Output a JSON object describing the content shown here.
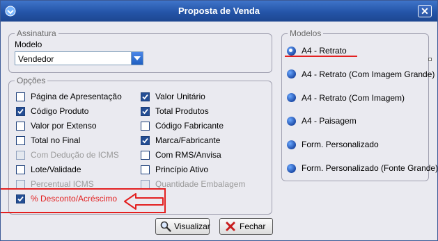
{
  "window": {
    "title": "Proposta de Venda"
  },
  "assinatura": {
    "legend": "Assinatura",
    "modelo_label": "Modelo",
    "modelo_value": "Vendedor"
  },
  "opcoes": {
    "legend": "Opções",
    "left": [
      {
        "label": "Página de Apresentação",
        "checked": false,
        "disabled": false
      },
      {
        "label": "Código Produto",
        "checked": true,
        "disabled": false
      },
      {
        "label": "Valor por Extenso",
        "checked": false,
        "disabled": false
      },
      {
        "label": "Total no Final",
        "checked": false,
        "disabled": false
      },
      {
        "label": "Com Dedução de ICMS",
        "checked": false,
        "disabled": true
      },
      {
        "label": "Lote/Validade",
        "checked": false,
        "disabled": false
      },
      {
        "label": "Percentual ICMS",
        "checked": false,
        "disabled": true
      },
      {
        "label": "% Desconto/Acréscimo",
        "checked": true,
        "disabled": false
      }
    ],
    "right": [
      {
        "label": "Valor Unitário",
        "checked": true,
        "disabled": false
      },
      {
        "label": "Total Produtos",
        "checked": true,
        "disabled": false
      },
      {
        "label": "Código Fabricante",
        "checked": false,
        "disabled": false
      },
      {
        "label": "Marca/Fabricante",
        "checked": true,
        "disabled": false
      },
      {
        "label": "Com RMS/Anvisa",
        "checked": false,
        "disabled": false
      },
      {
        "label": "Princípio Ativo",
        "checked": false,
        "disabled": false
      },
      {
        "label": "Quantidade Embalagem",
        "checked": false,
        "disabled": true
      }
    ]
  },
  "modelos": {
    "legend": "Modelos",
    "items": [
      {
        "label": "A4 - Retrato",
        "selected": true
      },
      {
        "label": "A4 - Retrato (Com Imagem Grande)",
        "selected": false
      },
      {
        "label": "A4 - Retrato (Com Imagem)",
        "selected": false
      },
      {
        "label": "A4 - Paisagem",
        "selected": false
      },
      {
        "label": "Form. Personalizado",
        "selected": false
      },
      {
        "label": "Form. Personalizado (Fonte Grande)",
        "selected": false
      }
    ]
  },
  "buttons": {
    "visualizar": "Visualizar",
    "fechar": "Fechar"
  },
  "colors": {
    "annotation": "#e32020",
    "title_bar": "#2454a8"
  }
}
